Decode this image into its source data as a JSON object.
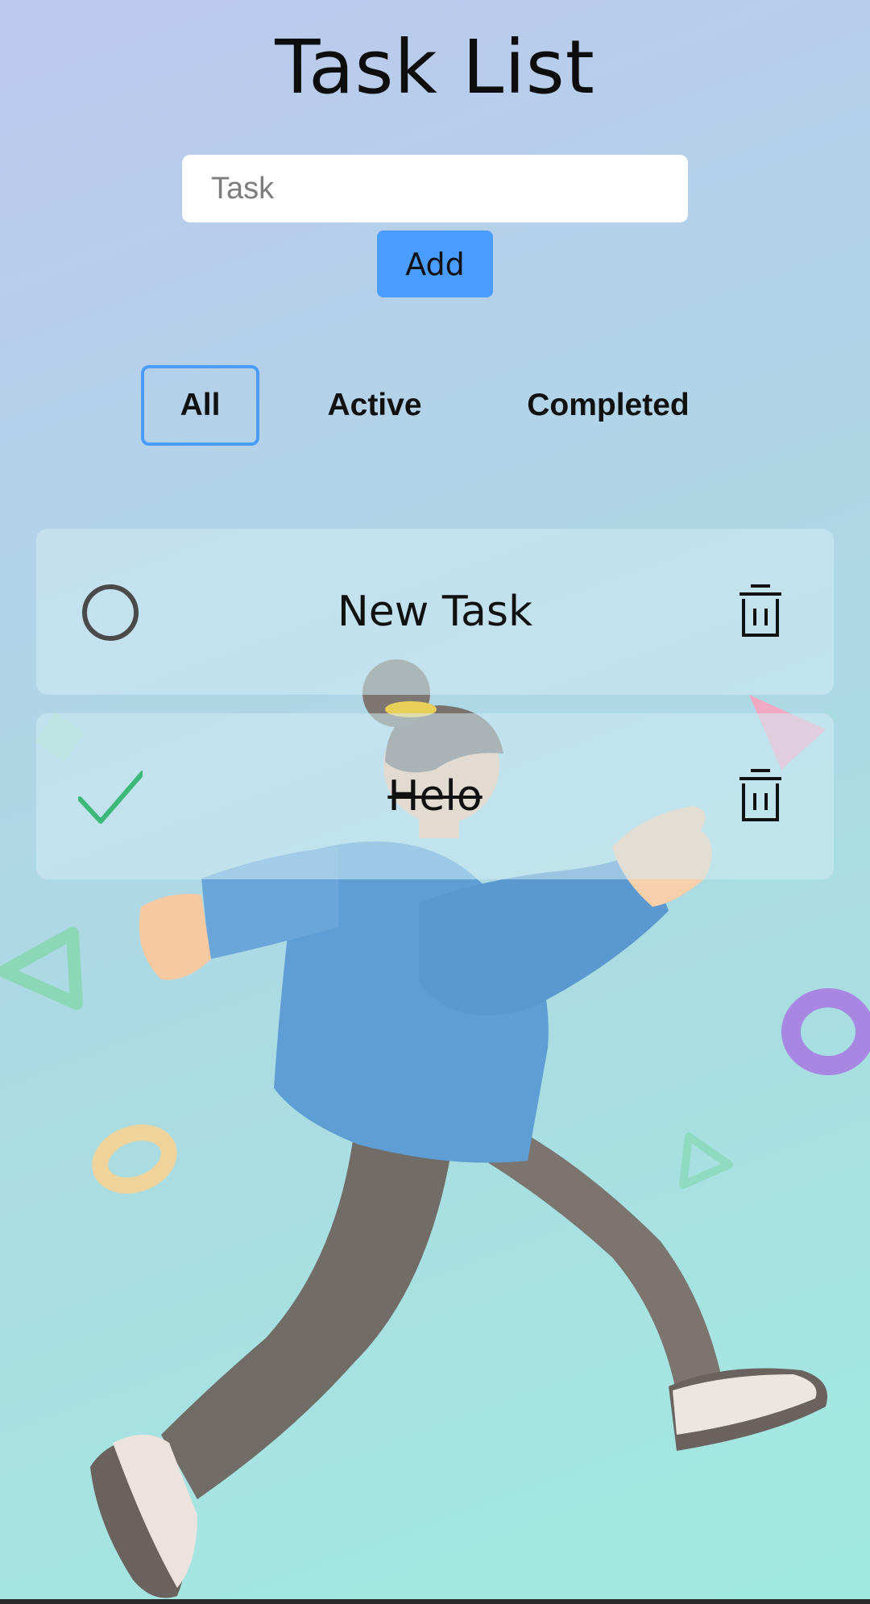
{
  "header": {
    "title": "Task List"
  },
  "form": {
    "placeholder": "Task",
    "value": "",
    "add_label": "Add"
  },
  "filters": [
    {
      "label": "All",
      "selected": true
    },
    {
      "label": "Active",
      "selected": false
    },
    {
      "label": "Completed",
      "selected": false
    }
  ],
  "tasks": [
    {
      "text": "New Task",
      "completed": false
    },
    {
      "text": "Helo",
      "completed": true
    }
  ],
  "colors": {
    "accent": "#4b9cff",
    "check": "#3cb878",
    "circle": "#4a4a4a"
  },
  "icons": {
    "incomplete": "circle-icon",
    "complete": "checkmark-icon",
    "delete": "trash-icon"
  }
}
